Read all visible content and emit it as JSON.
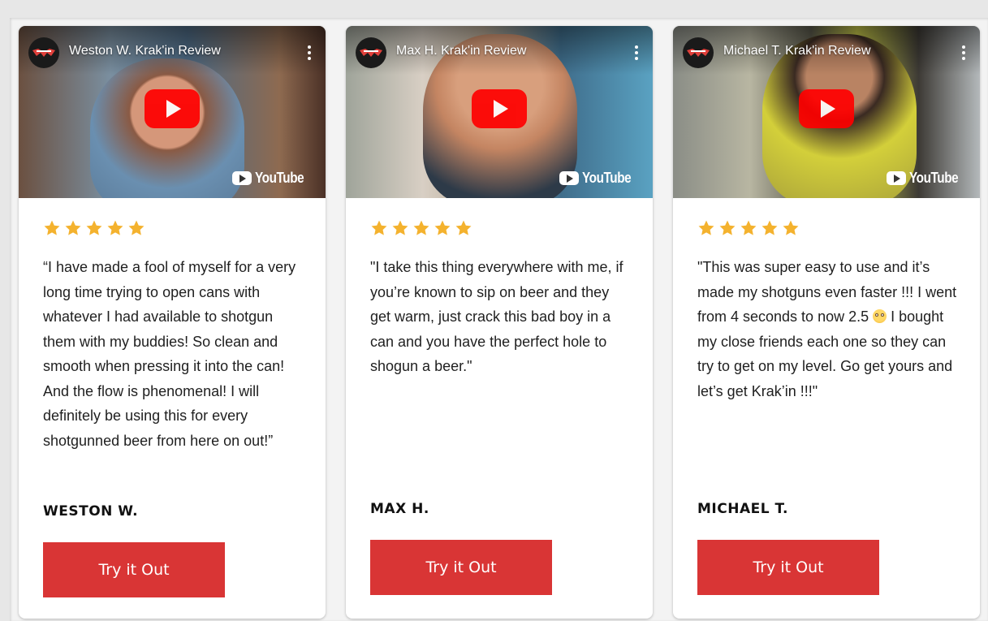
{
  "reviews": [
    {
      "video_title": "Weston W. Krak'in Review",
      "quote": "“I have made a fool of myself for a very long time trying to open cans with whatever I had available to shotgun them with my buddies! So clean and smooth when pressing it into the can! And the flow is phenomenal! I will definitely be using this for every shotgunned beer from here on out!”",
      "quote_after_emoji": "",
      "reviewer": "WESTON W.",
      "cta": "Try it Out",
      "rating": 5
    },
    {
      "video_title": "Max H. Krak'in Review",
      "quote": "\"I take this thing everywhere with me, if you’re known to sip on beer and they get warm, just crack this bad boy in a can and you have the perfect hole to shogun a beer.\"",
      "quote_after_emoji": "",
      "reviewer": "MAX H.",
      "cta": "Try it Out",
      "rating": 5
    },
    {
      "video_title": "Michael T. Krak'in Review",
      "quote": "\"This was super easy to use and it’s made my shotguns even faster !!! I went from 4 seconds to now 2.5 ",
      "quote_after_emoji": " I bought my close friends each one so they can try to get on my level. Go get yours and let’s get Krak’in !!!\"",
      "reviewer": "MICHAEL T.",
      "cta": "Try it Out",
      "rating": 5
    }
  ],
  "youtube_label": "YouTube",
  "icons": {
    "star": "star-icon",
    "play": "play-icon",
    "more": "more-vertical-icon",
    "logo": "youtube-logo-icon",
    "emoji": "flushed-face-emoji"
  },
  "colors": {
    "star": "#f4b22e",
    "cta_bg": "#d93535",
    "youtube_red": "#ff0000"
  }
}
